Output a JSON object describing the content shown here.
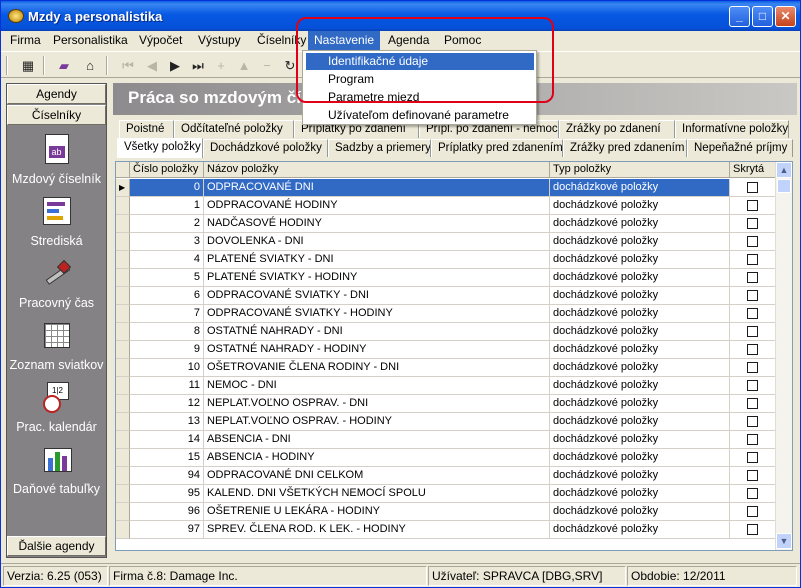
{
  "window": {
    "title": "Mzdy a personalistika",
    "minimize": "_",
    "maximize": "□",
    "close": "✕"
  },
  "menu": [
    {
      "label": "Firma"
    },
    {
      "label": "Personalistika"
    },
    {
      "label": "Výpočet"
    },
    {
      "label": "Výstupy"
    },
    {
      "label": "Číselníky"
    },
    {
      "label": "Nastavenie"
    },
    {
      "label": "Agenda"
    },
    {
      "label": "Pomoc"
    }
  ],
  "dropdown": {
    "items": [
      "Identifikačné údaje",
      "Program",
      "Parametre miezd",
      "Užívateľom definované parametre"
    ]
  },
  "colors": {
    "highlight": "#316ac5",
    "annotation": "#e0001a"
  },
  "sidebar": {
    "agendy": "Agendy",
    "ciselniky": "Číselníky",
    "items": [
      {
        "label": "Mzdový číselník",
        "icon": "document-ab-icon"
      },
      {
        "label": "Strediská",
        "icon": "org-chart-icon"
      },
      {
        "label": "Pracovný čas",
        "icon": "tools-icon"
      },
      {
        "label": "Zoznam sviatkov",
        "icon": "calendar-icon"
      },
      {
        "label": "Prac. kalendár",
        "icon": "clock-calendar-icon"
      },
      {
        "label": "Daňové tabuľky",
        "icon": "bar-chart-icon"
      }
    ],
    "dalsie": "Ďalšie agendy"
  },
  "header": {
    "title": "Práca so mzdovým čís"
  },
  "tabs_row1": [
    "Poistné",
    "Odčítateľné položky",
    "Príplatky po zdanení",
    "Prípl. po zdanení - nemoc",
    "Zrážky po zdanení",
    "Informatívne položky"
  ],
  "tabs_row2": [
    "Všetky položky",
    "Dochádzkové položky",
    "Sadzby a priemery",
    "Príplatky pred zdanením",
    "Zrážky pred zdanením",
    "Nepeňažné príjmy"
  ],
  "grid": {
    "columns": [
      "Číslo položky",
      "Názov položky",
      "Typ položky",
      "Skrytá"
    ],
    "rows": [
      [
        "0",
        "ODPRACOVANÉ DNI",
        "dochádzkové položky"
      ],
      [
        "1",
        "ODPRACOVANÉ HODINY",
        "dochádzkové položky"
      ],
      [
        "2",
        "NADČASOVÉ HODINY",
        "dochádzkové položky"
      ],
      [
        "3",
        "DOVOLENKA - DNI",
        "dochádzkové položky"
      ],
      [
        "4",
        "PLATENÉ SVIATKY - DNI",
        "dochádzkové položky"
      ],
      [
        "5",
        "PLATENÉ SVIATKY - HODINY",
        "dochádzkové položky"
      ],
      [
        "6",
        "ODPRACOVANÉ SVIATKY - DNI",
        "dochádzkové položky"
      ],
      [
        "7",
        "ODPRACOVANÉ SVIATKY - HODINY",
        "dochádzkové položky"
      ],
      [
        "8",
        "OSTATNÉ NAHRADY - DNI",
        "dochádzkové položky"
      ],
      [
        "9",
        "OSTATNÉ NAHRADY - HODINY",
        "dochádzkové položky"
      ],
      [
        "10",
        "OŠETROVANIE ČLENA RODINY - DNI",
        "dochádzkové položky"
      ],
      [
        "11",
        "NEMOC - DNI",
        "dochádzkové položky"
      ],
      [
        "12",
        "NEPLAT.VOĽNO OSPRAV. - DNI",
        "dochádzkové položky"
      ],
      [
        "13",
        "NEPLAT.VOĽNO OSPRAV. - HODINY",
        "dochádzkové položky"
      ],
      [
        "14",
        "ABSENCIA - DNI",
        "dochádzkové položky"
      ],
      [
        "15",
        "ABSENCIA - HODINY",
        "dochádzkové položky"
      ],
      [
        "94",
        "ODPRACOVANÉ DNI CELKOM",
        "dochádzkové položky"
      ],
      [
        "95",
        "KALEND. DNI VŠETKÝCH NEMOCÍ SPOLU",
        "dochádzkové položky"
      ],
      [
        "96",
        "OŠETRENIE U LEKÁRA - HODINY",
        "dochádzkové položky"
      ],
      [
        "97",
        "SPREV. ČLENA ROD. K LEK. - HODINY",
        "dochádzkové položky"
      ]
    ],
    "selected_index": 0
  },
  "status": {
    "version": "Verzia: 6.25 (053)",
    "company": "Firma č.8: Damage Inc.",
    "user": "Užívateľ: SPRAVCA [DBG,SRV]",
    "period": "Obdobie: 12/2011"
  }
}
